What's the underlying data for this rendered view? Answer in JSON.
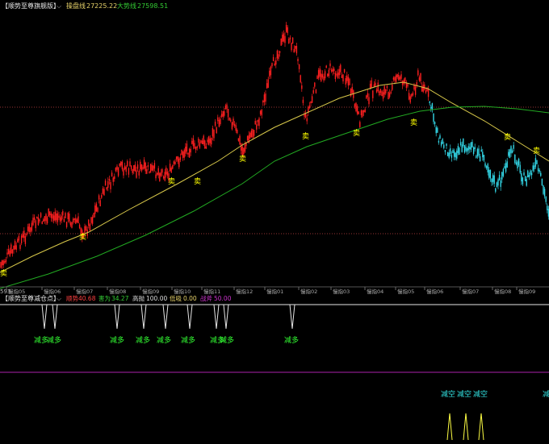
{
  "colors": {
    "bg": "#000000",
    "up": "#ff2020",
    "down": "#33d8e8",
    "ma_operator": "#d8c84a",
    "ma_trend": "#22aa22",
    "sell_marker": "#ffff00",
    "reduce_long": "#33ff33",
    "reduce_short": "#33e6e6",
    "hline": "#993333",
    "purple_line": "#aa22aa",
    "oscillator": "#e6e6e6",
    "osc2": "#ffff44"
  },
  "header": {
    "title": "【顺势至尊旗舰版】",
    "dropdown_icon": "chevron-down-icon",
    "items": [
      {
        "label": "操盘线",
        "value": "27225.22",
        "color": "#e8d36a"
      },
      {
        "label": "大势线",
        "value": "27598.51",
        "color": "#33cc33"
      }
    ]
  },
  "axis": {
    "left_value": "593",
    "x_ticks": [
      "05",
      "06",
      "07",
      "08",
      "09",
      "10",
      "11",
      "12",
      "01",
      "02",
      "03",
      "04",
      "05",
      "06",
      "07",
      "08",
      "09"
    ],
    "x_prefix": "慢指"
  },
  "sub_header": {
    "title": "【顺势至尊减仓点】",
    "items": [
      {
        "label": "顺势",
        "value": "40.68",
        "color": "#ff4040"
      },
      {
        "label": "害为",
        "value": "34.27",
        "color": "#33cc33"
      },
      {
        "label": "高抛",
        "value": "100.00",
        "color": "#dddddd"
      },
      {
        "label": "低吸",
        "value": "0.00",
        "color": "#e8d36a"
      },
      {
        "label": "战斧",
        "value": "50.00",
        "color": "#cc33cc"
      }
    ]
  },
  "markers": {
    "sell": "卖",
    "reduce_long": "减多",
    "reduce_short": "减空"
  },
  "chart_data": {
    "type": "candlestick",
    "series": [
      {
        "name": "操盘线",
        "values": [
          27225.22
        ]
      },
      {
        "name": "大势线",
        "values": [
          27598.51
        ]
      }
    ]
  }
}
